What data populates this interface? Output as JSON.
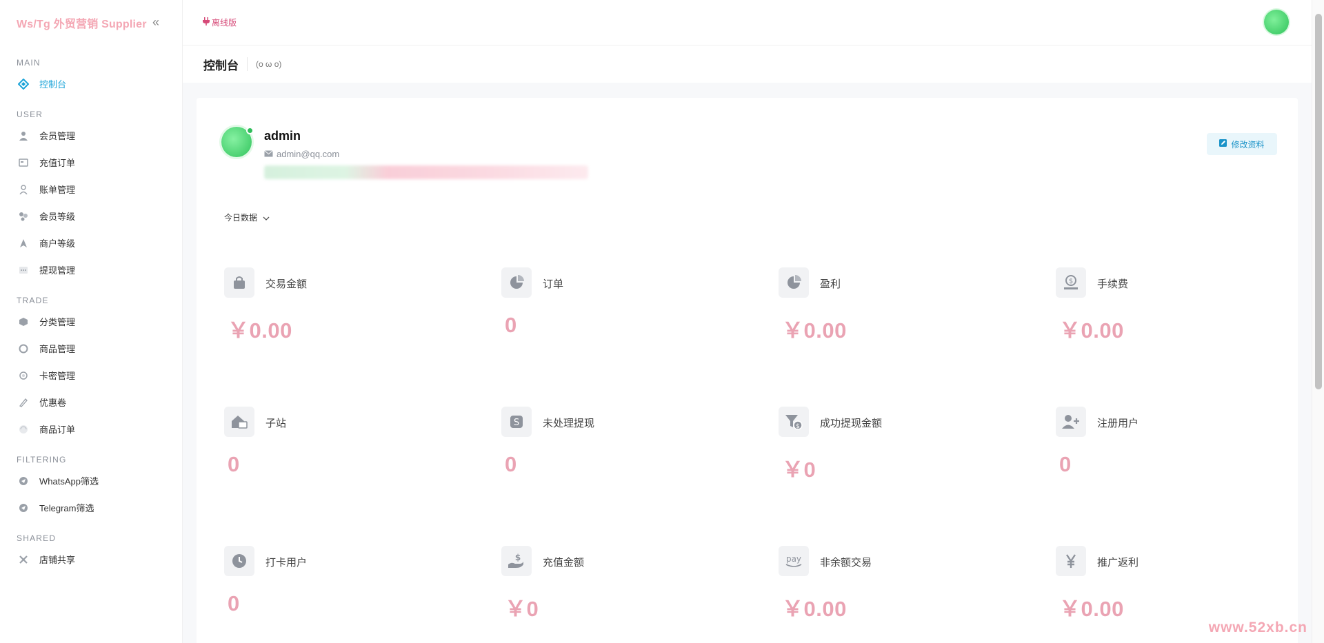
{
  "brand": {
    "title": "Ws/Tg 外贸营销 Supplier"
  },
  "sidebar": {
    "sections": [
      {
        "heading": "MAIN",
        "items": [
          {
            "label": "控制台",
            "icon": "dashboard-icon",
            "active": true
          }
        ]
      },
      {
        "heading": "USER",
        "items": [
          {
            "label": "会员管理",
            "icon": "user-icon"
          },
          {
            "label": "充值订单",
            "icon": "recharge-icon"
          },
          {
            "label": "账单管理",
            "icon": "bill-icon"
          },
          {
            "label": "会员等级",
            "icon": "level-icon"
          },
          {
            "label": "商户等级",
            "icon": "merchant-level-icon"
          },
          {
            "label": "提现管理",
            "icon": "withdraw-icon"
          }
        ]
      },
      {
        "heading": "TRADE",
        "items": [
          {
            "label": "分类管理",
            "icon": "category-icon"
          },
          {
            "label": "商品管理",
            "icon": "goods-icon"
          },
          {
            "label": "卡密管理",
            "icon": "card-icon"
          },
          {
            "label": "优惠卷",
            "icon": "coupon-icon"
          },
          {
            "label": "商品订单",
            "icon": "order-icon"
          }
        ]
      },
      {
        "heading": "FILTERING",
        "items": [
          {
            "label": "WhatsApp筛选",
            "icon": "whatsapp-filter-icon"
          },
          {
            "label": "Telegram筛选",
            "icon": "telegram-filter-icon"
          }
        ]
      },
      {
        "heading": "SHARED",
        "items": [
          {
            "label": "店铺共享",
            "icon": "share-icon"
          }
        ]
      }
    ]
  },
  "header": {
    "offline_label": "离线版"
  },
  "page": {
    "title": "控制台",
    "emoticon": "(o ω o)"
  },
  "profile": {
    "name": "admin",
    "email": "admin@qq.com",
    "edit_label": "修改资料"
  },
  "range": {
    "selected": "今日数据"
  },
  "stats": [
    {
      "label": "交易金额",
      "value": "￥0.00",
      "icon": "bag-icon"
    },
    {
      "label": "订单",
      "value": "0",
      "icon": "pie-chart-icon"
    },
    {
      "label": "盈利",
      "value": "￥0.00",
      "icon": "pie-chart-icon"
    },
    {
      "label": "手续费",
      "value": "￥0.00",
      "icon": "money-hand-icon"
    },
    {
      "label": "子站",
      "value": "0",
      "icon": "house-icon"
    },
    {
      "label": "未处理提现",
      "value": "0",
      "icon": "dollar-icon"
    },
    {
      "label": "成功提现金额",
      "value": "￥0",
      "icon": "funnel-dollar-icon"
    },
    {
      "label": "注册用户",
      "value": "0",
      "icon": "user-plus-icon"
    },
    {
      "label": "打卡用户",
      "value": "0",
      "icon": "clock-icon"
    },
    {
      "label": "充值金额",
      "value": "￥0",
      "icon": "hand-dollar-icon"
    },
    {
      "label": "非余额交易",
      "value": "￥0.00",
      "icon": "pay-icon"
    },
    {
      "label": "推广返利",
      "value": "￥0.00",
      "icon": "yen-icon"
    }
  ],
  "watermark": "www.52xb.cn",
  "colors": {
    "accent": "#1aa3d8",
    "value_pink": "#eaa3b3",
    "brand_pink": "#f4a7b4"
  }
}
